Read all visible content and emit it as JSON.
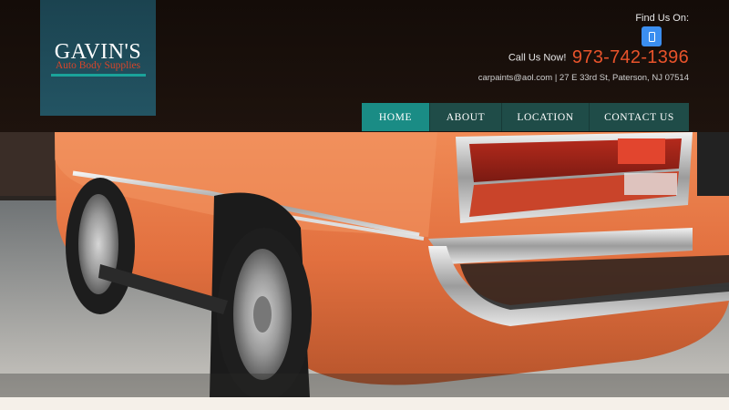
{
  "logo": {
    "title": "GAVIN'S",
    "subtitle": "Auto Body Supplies"
  },
  "header": {
    "find_us": "Find Us On:",
    "find_icon": "phone-icon",
    "call_label": "Call Us Now!",
    "phone": "973-742-1396",
    "contact_line": "carpaints@aol.com | 27 E 33rd St, Paterson, NJ 07514"
  },
  "nav": {
    "items": [
      {
        "label": "HOME",
        "active": true
      },
      {
        "label": "ABOUT",
        "active": false
      },
      {
        "label": "LOCATION",
        "active": false
      },
      {
        "label": "CONTACT US",
        "active": false
      }
    ]
  },
  "colors": {
    "accent": "#1a8c85",
    "logo_bg": "#1b4350",
    "phone": "#e8532b",
    "car_orange": "#e2703f"
  }
}
